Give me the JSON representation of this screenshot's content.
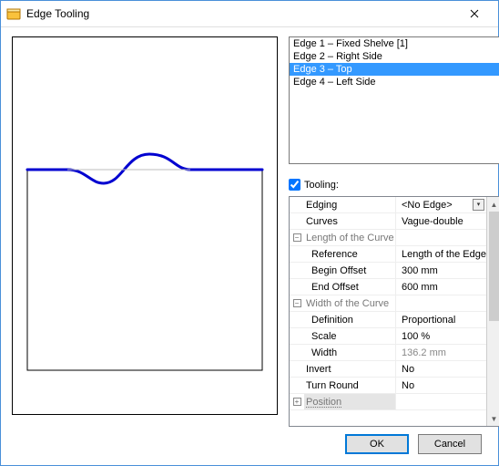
{
  "window": {
    "title": "Edge Tooling",
    "close_icon": "×"
  },
  "edges": {
    "items": [
      {
        "label": "Edge 1 – Fixed Shelve [1]",
        "selected": false
      },
      {
        "label": "Edge 2 – Right Side",
        "selected": false
      },
      {
        "label": "Edge 3 – Top",
        "selected": true
      },
      {
        "label": "Edge 4 – Left Side",
        "selected": false
      }
    ]
  },
  "tooling": {
    "checkbox_label": "Tooling:",
    "checked": true
  },
  "props": {
    "rows": [
      {
        "kind": "prop",
        "label": "Edging",
        "value": "<No Edge>",
        "dropdown": true
      },
      {
        "kind": "prop",
        "label": "Curves",
        "value": "Vague-double"
      },
      {
        "kind": "group",
        "toggle": "-",
        "label": "Length of the Curve"
      },
      {
        "kind": "prop",
        "indent": true,
        "label": "Reference",
        "value": "Length of the Edge"
      },
      {
        "kind": "prop",
        "indent": true,
        "label": "Begin Offset",
        "value": "300 mm"
      },
      {
        "kind": "prop",
        "indent": true,
        "label": "End Offset",
        "value": "600 mm"
      },
      {
        "kind": "group",
        "toggle": "-",
        "label": "Width of the Curve"
      },
      {
        "kind": "prop",
        "indent": true,
        "label": "Definition",
        "value": "Proportional"
      },
      {
        "kind": "prop",
        "indent": true,
        "label": "Scale",
        "value": "100 %"
      },
      {
        "kind": "prop",
        "indent": true,
        "label": "Width",
        "value": "136.2 mm",
        "disabled": true
      },
      {
        "kind": "prop",
        "label": "Invert",
        "value": "No"
      },
      {
        "kind": "prop",
        "label": "Turn Round",
        "value": "No"
      },
      {
        "kind": "group",
        "toggle": "+",
        "label": "Position",
        "highlight": true
      }
    ]
  },
  "buttons": {
    "ok": "OK",
    "cancel": "Cancel"
  },
  "colors": {
    "curve": "#0000d0",
    "selection": "#3399ff"
  }
}
